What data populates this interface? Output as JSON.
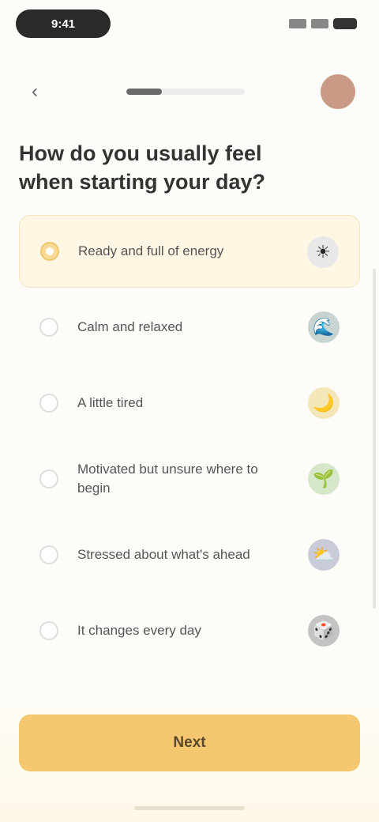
{
  "status": {
    "time": "9:41"
  },
  "nav": {
    "progress": 0.3
  },
  "question": "How do you usually feel when starting your day?",
  "options": [
    {
      "label": "Ready and full of energy",
      "emoji": "☀",
      "emoji_color": "#e8e8e8",
      "selected": true
    },
    {
      "label": "Calm and relaxed",
      "emoji": "🌊",
      "emoji_color": "#c8d4d2",
      "selected": false
    },
    {
      "label": "A little tired",
      "emoji": "🌙",
      "emoji_color": "#f3e6b8",
      "selected": false
    },
    {
      "label": "Motivated but unsure where to begin",
      "emoji": "🌱",
      "emoji_color": "#d6e6c8",
      "selected": false
    },
    {
      "label": "Stressed about what's ahead",
      "emoji": "⛅",
      "emoji_color": "#c9ccd8",
      "selected": false
    },
    {
      "label": "It changes every day",
      "emoji": "🎲",
      "emoji_color": "#c4c2c2",
      "selected": false
    }
  ],
  "continue_label": "Next",
  "colors": {
    "accent": "#f4c870",
    "selected_bg": "#fff6e3"
  }
}
